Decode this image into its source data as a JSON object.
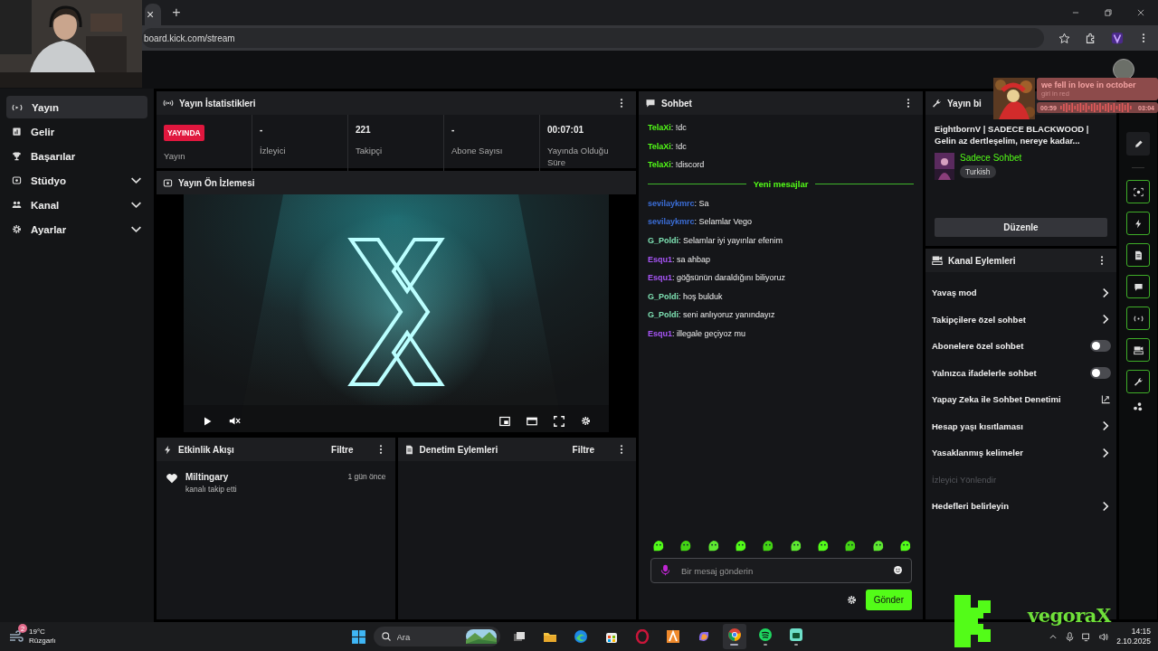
{
  "browser": {
    "tab_close": "×",
    "new_tab": "+",
    "url": "board.kick.com/stream"
  },
  "music_widget": {
    "title": "we fell in love in october",
    "artist": "girl in red",
    "elapsed": "00:59",
    "duration": "03:04"
  },
  "sidebar": {
    "items": [
      {
        "label": "Yayın",
        "kind": "link",
        "selected": true
      },
      {
        "label": "Gelir",
        "kind": "link",
        "selected": false
      },
      {
        "label": "Başarılar",
        "kind": "link",
        "selected": false
      },
      {
        "label": "Stüdyo",
        "kind": "group",
        "selected": false
      },
      {
        "label": "Kanal",
        "kind": "group",
        "selected": false
      },
      {
        "label": "Ayarlar",
        "kind": "group",
        "selected": false
      }
    ]
  },
  "stats": {
    "title": "Yayın İstatistikleri",
    "status_badge": "YAYINDA",
    "status_label": "Yayın",
    "cells": [
      {
        "value": "-",
        "label": "İzleyici"
      },
      {
        "value": "221",
        "label": "Takipçi"
      },
      {
        "value": "-",
        "label": "Abone Sayısı"
      },
      {
        "value": "00:07:01",
        "label": "Yayında Olduğu Süre"
      }
    ]
  },
  "preview": {
    "title": "Yayın Ön İzlemesi"
  },
  "activity": {
    "title": "Etkinlik Akışı",
    "filter": "Filtre",
    "events": [
      {
        "user": "Miltingary",
        "action": "kanalı takip etti",
        "time": "1 gün önce"
      }
    ]
  },
  "moderation": {
    "title": "Denetim Eylemleri",
    "filter": "Filtre"
  },
  "chat": {
    "title": "Sohbet",
    "messages": [
      {
        "kind": "message",
        "user": "TelaXi",
        "color": "#53fc18",
        "text": ": !dc"
      },
      {
        "kind": "message",
        "user": "TelaXi",
        "color": "#53fc18",
        "text": ": !dc"
      },
      {
        "kind": "message",
        "user": "TelaXi",
        "color": "#53fc18",
        "text": ": !discord"
      },
      {
        "kind": "divider",
        "text": "Yeni mesajlar"
      },
      {
        "kind": "message",
        "user": "sevilaykmrc",
        "color": "#3c6fd9",
        "text": ": Sa"
      },
      {
        "kind": "message",
        "user": "sevilaykmrc",
        "color": "#3c6fd9",
        "text": ": Selamlar Vego"
      },
      {
        "kind": "message",
        "user": "G_Poldi",
        "color": "#7fe3b4",
        "text": ": Selamlar iyi yayınlar efenim"
      },
      {
        "kind": "message",
        "user": "Esqu1",
        "color": "#a855f7",
        "text": ": sa ahbap"
      },
      {
        "kind": "message",
        "user": "Esqu1",
        "color": "#a855f7",
        "text": ": göğsünün daraldığını biliyoruz"
      },
      {
        "kind": "message",
        "user": "G_Poldi",
        "color": "#7fe3b4",
        "text": ": hoş bulduk"
      },
      {
        "kind": "message",
        "user": "G_Poldi",
        "color": "#7fe3b4",
        "text": ": seni anlıyoruz yanındayız"
      },
      {
        "kind": "message",
        "user": "Esqu1",
        "color": "#a855f7",
        "text": ": illegale geçiyoz mu"
      }
    ],
    "placeholder": "Bir mesaj gönderin",
    "send": "Gönder"
  },
  "stream_info": {
    "title": "Yayın bi",
    "stream_title": "EightbornV | SADECE BLACKWOOD | Gelin az dertleşelim, nereye kadar...",
    "category": "Sadece Sohbet",
    "tags": [
      "Turkish"
    ],
    "edit": "Düzenle"
  },
  "channel_actions": {
    "title": "Kanal Eylemleri",
    "items": [
      {
        "label": "Yavaş mod",
        "kind": "submenu",
        "disabled": false
      },
      {
        "label": "Takipçilere özel sohbet",
        "kind": "submenu",
        "disabled": false
      },
      {
        "label": "Abonelere özel sohbet",
        "kind": "toggle",
        "on": false,
        "disabled": false
      },
      {
        "label": "Yalnızca ifadelerle sohbet",
        "kind": "toggle",
        "on": false,
        "disabled": false
      },
      {
        "label": "Yapay Zeka ile Sohbet Denetimi",
        "kind": "external",
        "disabled": false
      },
      {
        "label": "Hesap yaşı kısıtlaması",
        "kind": "submenu",
        "disabled": false
      },
      {
        "label": "Yasaklanmış kelimeler",
        "kind": "submenu",
        "disabled": false
      },
      {
        "label": "İzleyici Yönlendir",
        "kind": "plain",
        "disabled": true
      },
      {
        "label": "Hedefleri belirleyin",
        "kind": "submenu",
        "disabled": false
      }
    ]
  },
  "taskbar": {
    "weather_badge": "2",
    "temperature": "19°C",
    "weather": "Rüzgarlı",
    "search_placeholder": "Ara",
    "apps": [
      {
        "kind": "taskview",
        "running": false,
        "selected": false
      },
      {
        "kind": "folder",
        "running": false,
        "selected": false
      },
      {
        "kind": "edge",
        "running": false,
        "selected": false
      },
      {
        "kind": "store",
        "running": false,
        "selected": false
      },
      {
        "kind": "opera",
        "running": false,
        "selected": false
      },
      {
        "kind": "triangle",
        "running": false,
        "selected": false
      },
      {
        "kind": "copilot",
        "running": false,
        "selected": false
      },
      {
        "kind": "chrome",
        "running": true,
        "selected": true
      },
      {
        "kind": "spotify",
        "running": true,
        "selected": false
      },
      {
        "kind": "bot",
        "running": true,
        "selected": false
      }
    ],
    "time": "14:15",
    "date": "2.10.2025"
  },
  "overlay": {
    "brand_text": "vegoraX"
  }
}
